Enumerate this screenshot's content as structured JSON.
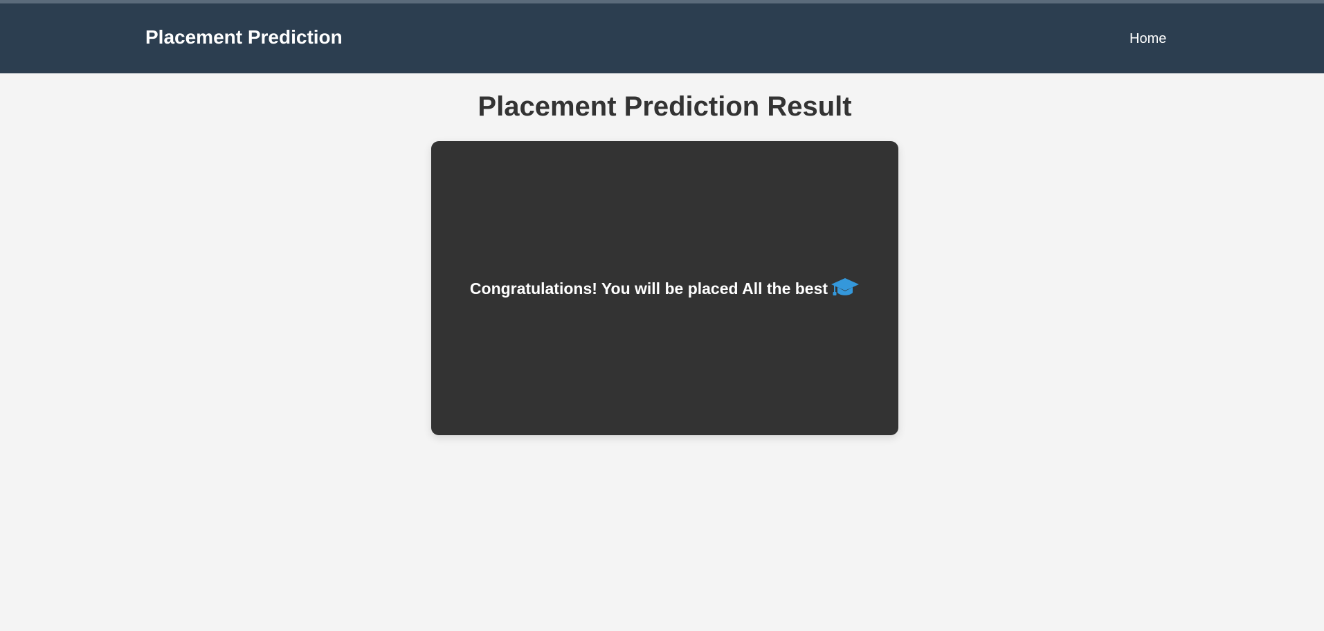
{
  "navbar": {
    "brand": "Placement Prediction",
    "links": [
      {
        "label": "Home"
      }
    ]
  },
  "main": {
    "title": "Placement Prediction Result",
    "result": {
      "message": "Congratulations! You will be placed All the best",
      "icon": "graduation-cap-icon"
    }
  },
  "colors": {
    "navbar_bg": "#2c3e50",
    "page_bg": "#f4f4f4",
    "card_bg": "#333333",
    "icon_accent": "#3498db",
    "title_text": "#333333"
  }
}
